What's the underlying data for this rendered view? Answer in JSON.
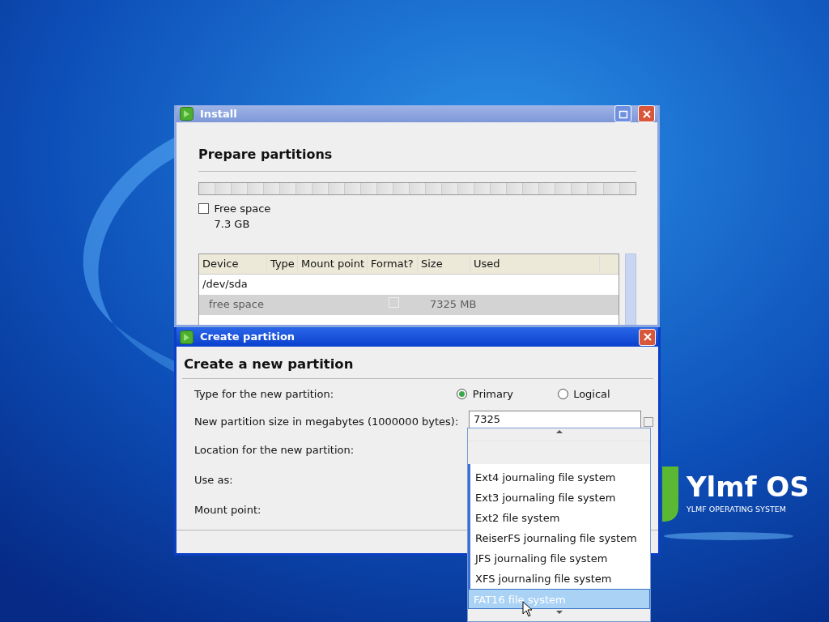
{
  "desktop": {
    "logo": {
      "title": "Ylmf OS",
      "subtitle": "YLMF OPERATING SYSTEM"
    }
  },
  "install_window": {
    "title": "Install",
    "heading": "Prepare partitions",
    "legend": [
      {
        "label": "Free space",
        "size": "7.3 GB",
        "checked": false
      }
    ],
    "table": {
      "columns": [
        "Device",
        "Type",
        "Mount point",
        "Format?",
        "Size",
        "Used"
      ],
      "rows": [
        {
          "device": "/dev/sda",
          "selected": false
        },
        {
          "device": "free space",
          "format": false,
          "size": "7325 MB",
          "selected": true
        }
      ]
    }
  },
  "dialog": {
    "title": "Create partition",
    "heading": "Create a new partition",
    "fields": [
      {
        "label": "Type for the new partition:",
        "kind": "radio",
        "options": [
          {
            "label": "Primary",
            "selected": true
          },
          {
            "label": "Logical",
            "selected": false
          }
        ]
      },
      {
        "label": "New partition size in megabytes (1000000 bytes):",
        "kind": "spin",
        "value": "7325"
      },
      {
        "label": "Location for the new partition:",
        "kind": "blank"
      },
      {
        "label": "Use as:",
        "kind": "blank"
      },
      {
        "label": "Mount point:",
        "kind": "blank"
      }
    ]
  },
  "dropdown": {
    "items": [
      {
        "label": "Ext4 journaling file system",
        "selected": false
      },
      {
        "label": "Ext3 journaling file system",
        "selected": false
      },
      {
        "label": "Ext2 file system",
        "selected": false
      },
      {
        "label": "ReiserFS journaling file system",
        "selected": false
      },
      {
        "label": "JFS journaling file system",
        "selected": false
      },
      {
        "label": "XFS journaling file system",
        "selected": false
      },
      {
        "label": "FAT16 file system",
        "selected": true
      }
    ]
  }
}
